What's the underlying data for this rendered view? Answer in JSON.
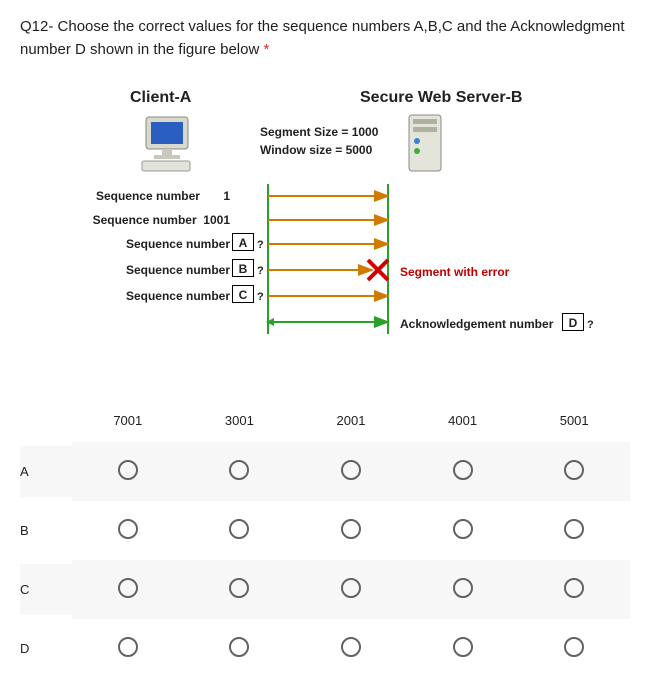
{
  "question": {
    "prefix": "Q12- ",
    "text": "Choose the correct values for the sequence numbers A,B,C and the Acknowledgment number D shown in the figure below",
    "required": "*"
  },
  "diagram": {
    "client_label": "Client-A",
    "server_label": "Secure Web Server-B",
    "segment_size": "Segment Size = 1000",
    "window_size": "Window size = 5000",
    "seq_label_text": "Sequence number",
    "seq1_value": "1",
    "seq2_value": "1001",
    "boxA": "A",
    "boxB": "B",
    "boxC": "C",
    "boxD": "D",
    "qmark": "?",
    "segment_error": "Segment with error",
    "ack_label": "Acknowledgement number"
  },
  "answers": {
    "columns": [
      "7001",
      "3001",
      "2001",
      "4001",
      "5001"
    ],
    "rows": [
      "A",
      "B",
      "C",
      "D"
    ]
  }
}
